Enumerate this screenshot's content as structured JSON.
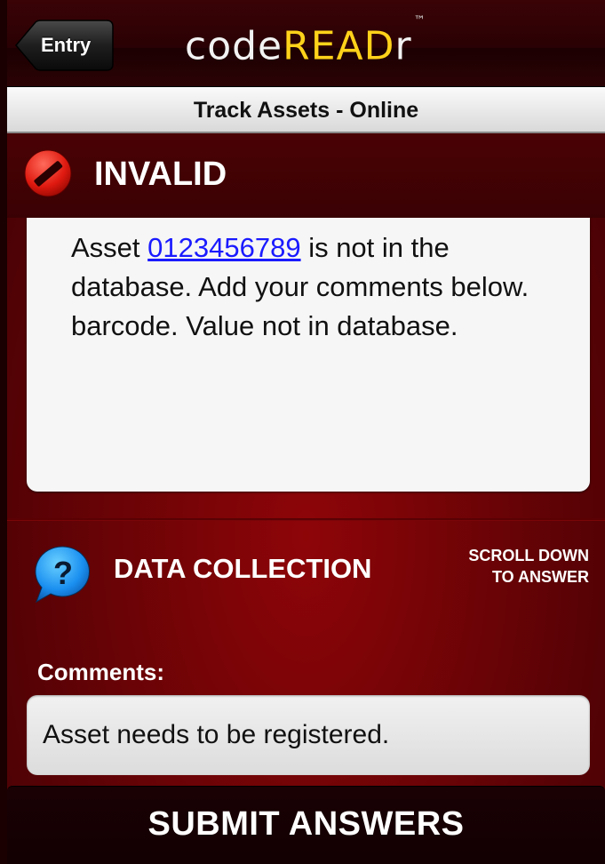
{
  "navbar": {
    "back_label": "Entry",
    "logo_code": "code",
    "logo_read": "READ",
    "logo_r": "r",
    "logo_tm": "™"
  },
  "subtitle": "Track Assets - Online",
  "status": {
    "label": "INVALID",
    "icon": "no-entry-icon"
  },
  "message": {
    "prefix": "Asset ",
    "asset_link": "0123456789",
    "suffix": " is not in the database. Add your comments below. barcode. Value not in database."
  },
  "data_collection": {
    "title": "DATA COLLECTION",
    "hint_line1": "SCROLL DOWN",
    "hint_line2": "TO ANSWER",
    "icon": "question-bubble-icon"
  },
  "comments": {
    "label": "Comments:",
    "value": "Asset needs to be registered."
  },
  "submit_label": "SUBMIT ANSWERS",
  "colors": {
    "background": "#6a0306",
    "accent_logo": "#ffd21a",
    "link": "#1a1aff"
  }
}
